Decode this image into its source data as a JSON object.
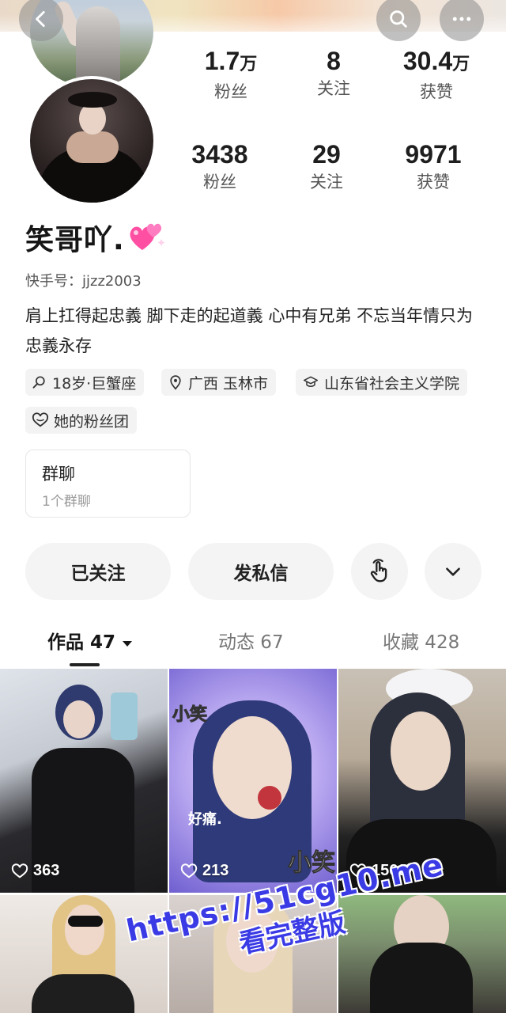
{
  "header": {
    "back_icon": "chevron-left-icon",
    "search_icon": "search-icon",
    "more_icon": "more-horizontal-icon"
  },
  "stats_primary": [
    {
      "num": "1.7",
      "unit": "万",
      "label": "粉丝"
    },
    {
      "num": "8",
      "unit": "",
      "label": "关注"
    },
    {
      "num": "30.4",
      "unit": "万",
      "label": "获赞"
    }
  ],
  "stats_secondary": [
    {
      "num": "3438",
      "label": "粉丝"
    },
    {
      "num": "29",
      "label": "关注"
    },
    {
      "num": "9971",
      "label": "获赞"
    }
  ],
  "profile": {
    "name": "笑哥吖.",
    "name_emoji": "sparkling-hearts-icon",
    "kuaishou_id": "快手号：jjzz2003",
    "bio": "肩上扛得起忠義 脚下走的起道義 心中有兄弟 不忘当年情只为 忠義永存"
  },
  "tags": [
    {
      "icon": "search-person-icon",
      "label": "18岁·巨蟹座"
    },
    {
      "icon": "location-pin-icon",
      "label": "广西 玉林市"
    },
    {
      "icon": "graduation-cap-icon",
      "label": "山东省社会主义学院"
    },
    {
      "icon": "heart-outline-icon",
      "label": "她的粉丝团"
    }
  ],
  "group_chat": {
    "title": "群聊",
    "subtitle": "1个群聊"
  },
  "actions": {
    "followed": "已关注",
    "message": "发私信",
    "tap_icon": "tap-finger-icon",
    "dropdown_icon": "chevron-down-icon"
  },
  "tabs": [
    {
      "label": "作品 47",
      "active": true
    },
    {
      "label": "动态 67",
      "active": false
    },
    {
      "label": "收藏 428",
      "active": false
    }
  ],
  "videos": [
    {
      "likes": "363"
    },
    {
      "likes": "213",
      "overlay": [
        "小笑",
        "好痛.",
        "小笑"
      ]
    },
    {
      "likes": "1560"
    },
    {
      "likes": ""
    },
    {
      "likes": ""
    },
    {
      "likes": ""
    }
  ],
  "watermark": {
    "line1": "https://51cg10.me",
    "line2": "看完整版"
  },
  "colors": {
    "accent_watermark": "#3b3be6",
    "tag_bg": "#f3f3f3",
    "button_bg": "#f4f4f4"
  }
}
